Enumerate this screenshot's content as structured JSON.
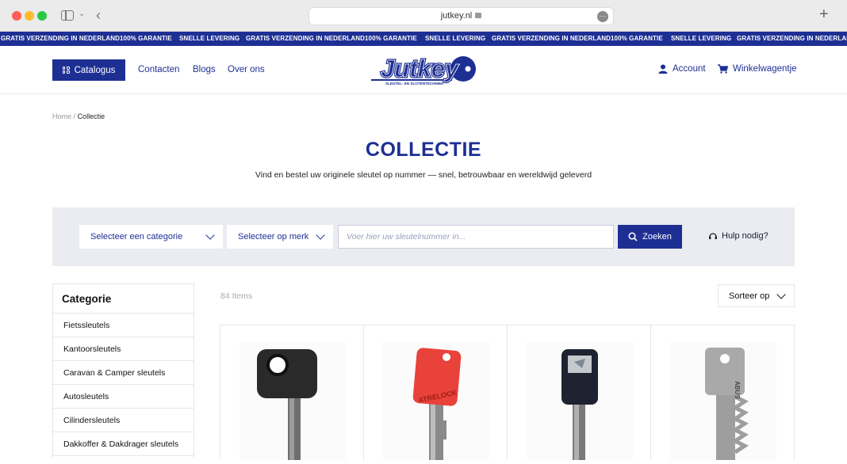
{
  "browser": {
    "url": "jutkey.nl"
  },
  "ticker": {
    "items": [
      "GRATIS VERZENDING IN NEDERLAND",
      "100% GARANTIE",
      "SNELLE LEVERING",
      "GRATIS VERZENDING IN NEDERLAND",
      "100% GARANTIE",
      "SNELLE LEVERING",
      "GRATIS VERZENDING IN NEDERLAND",
      "100% GARANTIE",
      "SNELLE LEVERING",
      "GRATIS VERZENDING IN NEDERLAND"
    ]
  },
  "header": {
    "catalog_label": "Catalogus",
    "nav": [
      "Contacten",
      "Blogs",
      "Over ons"
    ],
    "logo_text": "Jutkey",
    "logo_tagline": "SLEUTEL- EN SLOTENTECHNIEK",
    "account_label": "Account",
    "cart_label": "Winkelwagentje"
  },
  "breadcrumb": {
    "home": "Home",
    "separator": "/",
    "current": "Collectie"
  },
  "page": {
    "title": "COLLECTIE",
    "subtitle": "Vind en bestel uw originele sleutel op nummer — snel, betrouwbaar en wereldwijd geleverd"
  },
  "search": {
    "category_select": "Selecteer een categorie",
    "brand_select": "Selecteer op merk",
    "input_placeholder": "Voer hier uw sleutelnummer in...",
    "button_label": "Zoeken",
    "help_label": "Hulp nodig?"
  },
  "sidebar": {
    "title": "Categorie",
    "items": [
      "Fietssleutels",
      "Kantoorsleutels",
      "Caravan & Camper sleutels",
      "Autosleutels",
      "Cilindersleutels",
      "Dakkoffer & Dakdrager sleutels"
    ]
  },
  "listing": {
    "items_count": "84 Items",
    "sort_label": "Sorteer op"
  },
  "products": [
    {
      "name": "black-round-key",
      "head_color": "#2a2a2a"
    },
    {
      "name": "red-key",
      "head_color": "#e8423a",
      "brand_text": "ATRELOCK"
    },
    {
      "name": "black-rectangular-key",
      "head_color": "#1d2330"
    },
    {
      "name": "silver-key",
      "head_color": "#a9a9a9",
      "brand_text": "ABUS"
    }
  ],
  "colors": {
    "brand_blue": "#1e2f94",
    "panel_grey": "#ebecf2"
  }
}
